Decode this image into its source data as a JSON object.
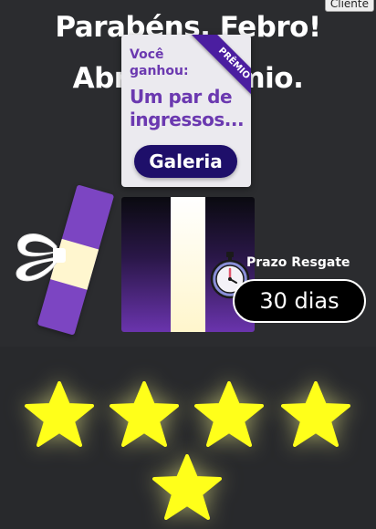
{
  "client_button": "Cliente",
  "headline": {
    "line1": "Parabéns, Febro!",
    "line2": "Abra o prêmio."
  },
  "prize_card": {
    "won_label": "Você ganhou:",
    "prize_text": "Um par de ingressos...",
    "ribbon_label": "PRÊMIO",
    "gallery_button": "Galeria"
  },
  "deadline": {
    "label": "Prazo Resgate",
    "value": "30 dias",
    "icon": "stopwatch-icon"
  },
  "rating": {
    "stars": 5
  },
  "colors": {
    "background": "#2b2c2f",
    "purple": "#7c45c2",
    "accent_dark": "#1e0f6a",
    "ribbon": "#4b1ea0",
    "star": "#ffff1a",
    "band": "#fff6cf"
  }
}
